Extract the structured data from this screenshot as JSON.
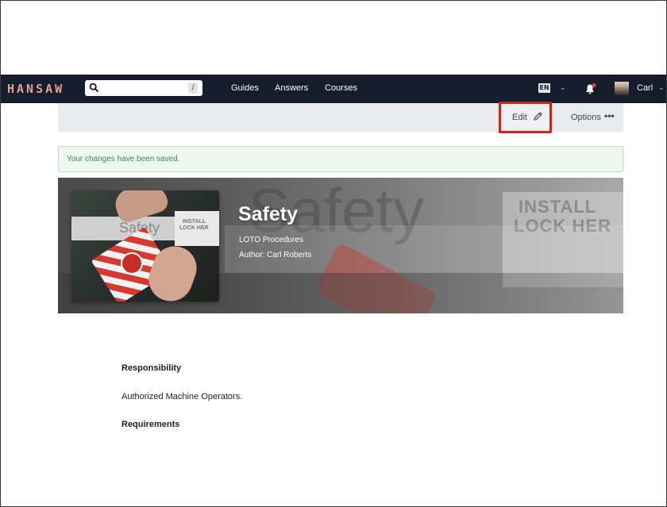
{
  "nav": {
    "logo": "HANSAW",
    "search_shortcut": "/",
    "links": [
      "Guides",
      "Answers",
      "Courses"
    ],
    "language": "EN",
    "user_name": "Carl"
  },
  "toolbar": {
    "edit_label": "Edit",
    "options_label": "Options",
    "options_glyph": "•••"
  },
  "alert": {
    "message": "Your changes have been saved."
  },
  "hero": {
    "title": "Safety",
    "subtitle": "LOTO Procedures",
    "author": "Author: Carl Roberts",
    "thumb_label": "Safety",
    "bg_word": "Safety",
    "sign_line1": "INSTALL",
    "sign_line2": "LOCK HER",
    "thumb_sign_line1": "INSTALL",
    "thumb_sign_line2": "LOCK HER"
  },
  "content": {
    "heading1": "Responsibility",
    "paragraph1": "Authorized Machine Operators.",
    "heading2": "Requirements"
  },
  "colors": {
    "nav_bg": "#151c2c",
    "logo": "#e0a09a",
    "highlight": "#c0291c",
    "alert_bg": "#eef8ef",
    "alert_text": "#3c8a4e"
  },
  "icons": {
    "search": "search-icon",
    "edit": "pencil-icon",
    "notifications": "bell-icon"
  }
}
